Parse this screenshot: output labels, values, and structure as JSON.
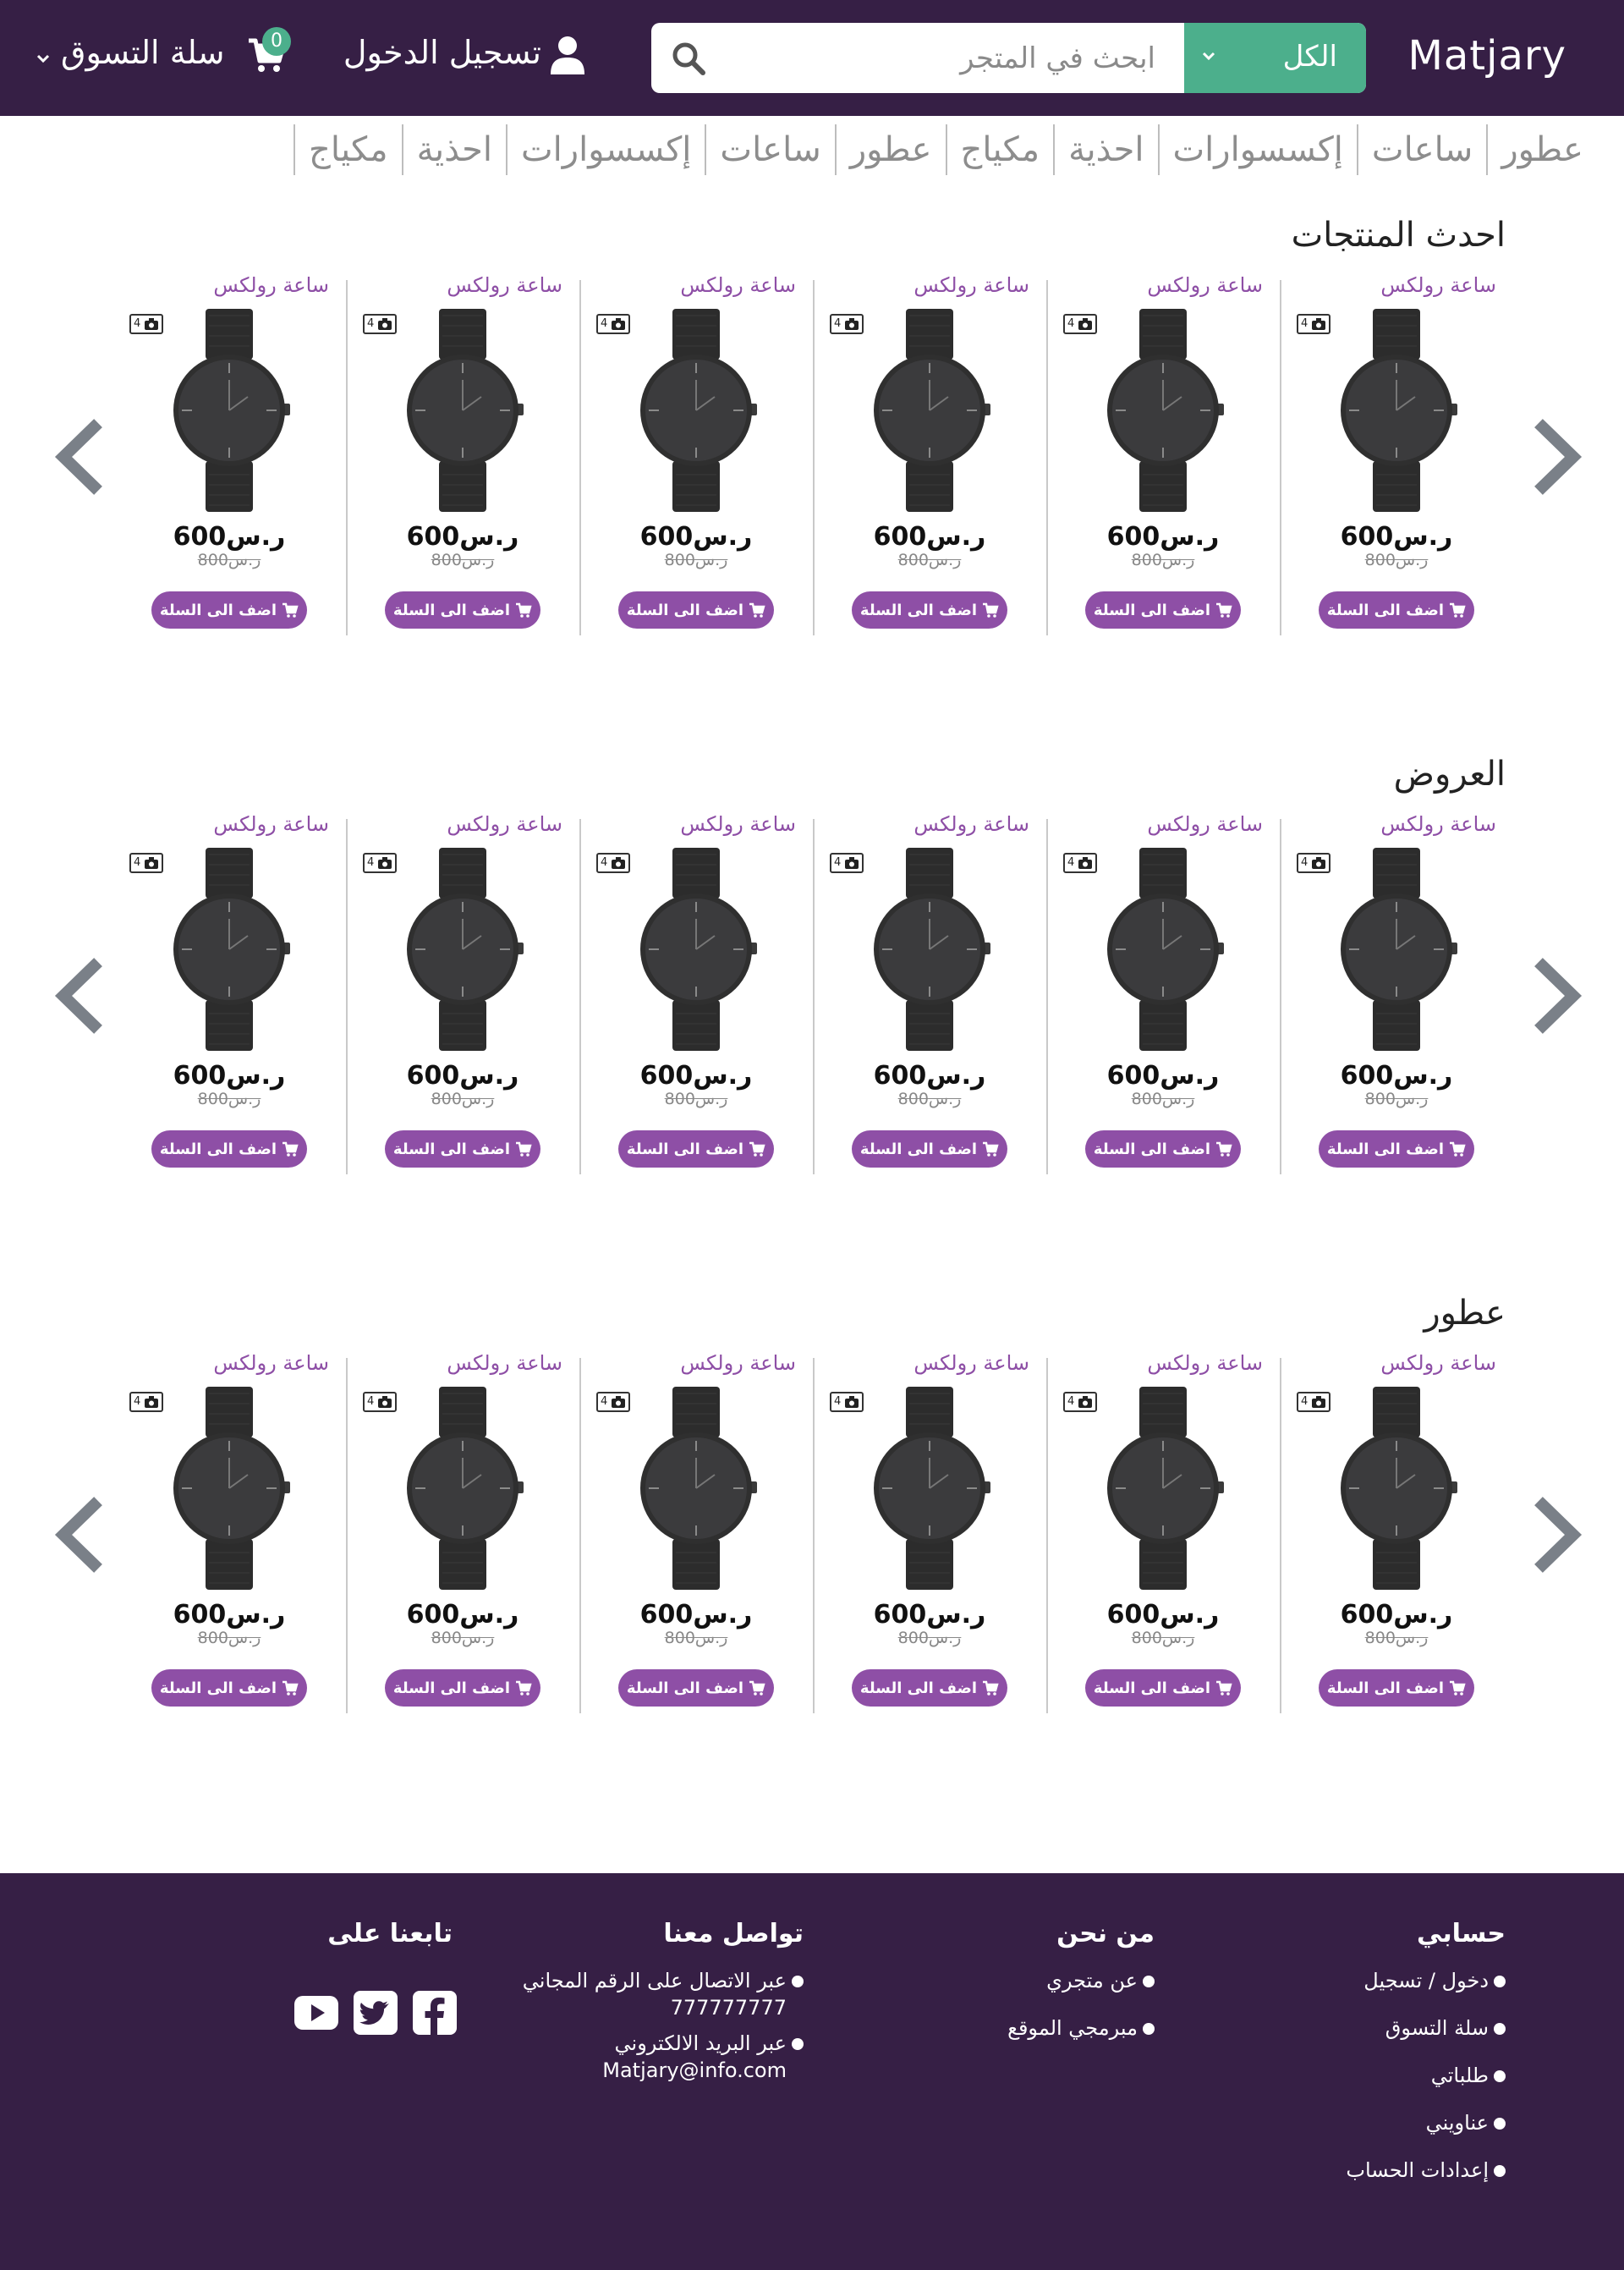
{
  "header": {
    "logo": "Matjary",
    "search": {
      "category": "الكل",
      "placeholder": "ابحث في المتجر"
    },
    "login_label": "تسجيل الدخول",
    "cart_label": "سلة التسوق",
    "cart_count": "0"
  },
  "nav": {
    "categories": [
      "عطور",
      "ساعات",
      "إكسسوارات",
      "احذية",
      "مكياج",
      "عطور",
      "ساعات",
      "إكسسوارات",
      "احذية",
      "مكياج"
    ]
  },
  "sections": [
    {
      "title": "احدث المنتجات",
      "products": [
        {
          "name": "ساعة رولكس",
          "price": "600ر.س",
          "old_price": "800ر.س",
          "badge": "4",
          "button": "اضف الى السلة"
        },
        {
          "name": "ساعة رولكس",
          "price": "600ر.س",
          "old_price": "800ر.س",
          "badge": "4",
          "button": "اضف الى السلة"
        },
        {
          "name": "ساعة رولكس",
          "price": "600ر.س",
          "old_price": "800ر.س",
          "badge": "4",
          "button": "اضف الى السلة"
        },
        {
          "name": "ساعة رولكس",
          "price": "600ر.س",
          "old_price": "800ر.س",
          "badge": "4",
          "button": "اضف الى السلة"
        },
        {
          "name": "ساعة رولكس",
          "price": "600ر.س",
          "old_price": "800ر.س",
          "badge": "4",
          "button": "اضف الى السلة"
        },
        {
          "name": "ساعة رولكس",
          "price": "600ر.س",
          "old_price": "800ر.س",
          "badge": "4",
          "button": "اضف الى السلة"
        }
      ]
    },
    {
      "title": "العروض",
      "products": [
        {
          "name": "ساعة رولكس",
          "price": "600ر.س",
          "old_price": "800ر.س",
          "badge": "4",
          "button": "اضف الى السلة"
        },
        {
          "name": "ساعة رولكس",
          "price": "600ر.س",
          "old_price": "800ر.س",
          "badge": "4",
          "button": "اضف الى السلة"
        },
        {
          "name": "ساعة رولكس",
          "price": "600ر.س",
          "old_price": "800ر.س",
          "badge": "4",
          "button": "اضف الى السلة"
        },
        {
          "name": "ساعة رولكس",
          "price": "600ر.س",
          "old_price": "800ر.س",
          "badge": "4",
          "button": "اضف الى السلة"
        },
        {
          "name": "ساعة رولكس",
          "price": "600ر.س",
          "old_price": "800ر.س",
          "badge": "4",
          "button": "اضف الى السلة"
        },
        {
          "name": "ساعة رولكس",
          "price": "600ر.س",
          "old_price": "800ر.س",
          "badge": "4",
          "button": "اضف الى السلة"
        }
      ]
    },
    {
      "title": "عطور",
      "products": [
        {
          "name": "ساعة رولكس",
          "price": "600ر.س",
          "old_price": "800ر.س",
          "badge": "4",
          "button": "اضف الى السلة"
        },
        {
          "name": "ساعة رولكس",
          "price": "600ر.س",
          "old_price": "800ر.س",
          "badge": "4",
          "button": "اضف الى السلة"
        },
        {
          "name": "ساعة رولكس",
          "price": "600ر.س",
          "old_price": "800ر.س",
          "badge": "4",
          "button": "اضف الى السلة"
        },
        {
          "name": "ساعة رولكس",
          "price": "600ر.س",
          "old_price": "800ر.س",
          "badge": "4",
          "button": "اضف الى السلة"
        },
        {
          "name": "ساعة رولكس",
          "price": "600ر.س",
          "old_price": "800ر.س",
          "badge": "4",
          "button": "اضف الى السلة"
        },
        {
          "name": "ساعة رولكس",
          "price": "600ر.س",
          "old_price": "800ر.س",
          "badge": "4",
          "button": "اضف الى السلة"
        }
      ]
    }
  ],
  "footer": {
    "account": {
      "title": "حسابي",
      "items": [
        "دخول / تسجيل",
        "سلة التسوق",
        "طلباتي",
        "عناويني",
        "إعدادات الحساب"
      ]
    },
    "about": {
      "title": "من نحن",
      "items": [
        "عن متجري",
        "مبرمجي الموقع"
      ]
    },
    "contact": {
      "title": "تواصل معنا",
      "phone_label": "عبر الاتصال على الرقم المجاني",
      "phone": "777777777",
      "email_label": "عبر البريد الالكتروني",
      "email": "Matjary@info.com"
    },
    "follow": {
      "title": "تابعنا على",
      "icons": [
        "facebook-icon",
        "twitter-icon",
        "youtube-icon"
      ]
    }
  },
  "colors": {
    "header_bg": "#361f45",
    "accent_green": "#4caf8c",
    "accent_purple": "#8e4fa6",
    "arrow_gray": "#7a8088"
  }
}
